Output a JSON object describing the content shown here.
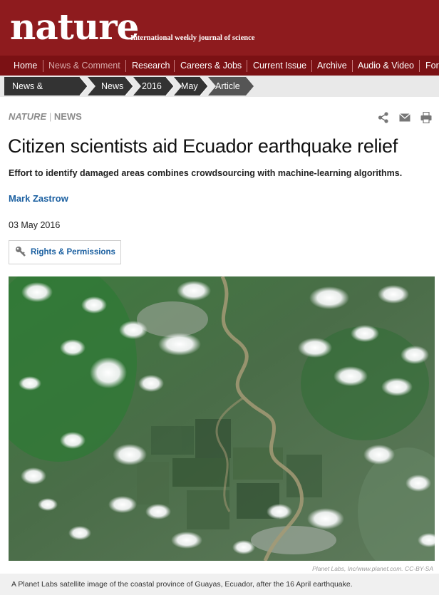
{
  "brand": {
    "logo": "nature",
    "tagline": "International weekly journal of science"
  },
  "nav": {
    "items": [
      {
        "label": "Home"
      },
      {
        "label": "News & Comment",
        "active": true
      },
      {
        "label": "Research"
      },
      {
        "label": "Careers & Jobs"
      },
      {
        "label": "Current Issue"
      },
      {
        "label": "Archive"
      },
      {
        "label": "Audio & Video"
      },
      {
        "label": "For"
      }
    ]
  },
  "breadcrumb": [
    "News & Comment",
    "News",
    "2016",
    "May",
    "Article"
  ],
  "article": {
    "kicker_journal": "NATURE",
    "kicker_sep": "|",
    "kicker_section": "NEWS",
    "title": "Citizen scientists aid Ecuador earthquake relief",
    "standfirst": "Effort to identify damaged areas combines crowdsourcing with machine-learning algorithms.",
    "author": "Mark Zastrow",
    "date": "03 May 2016",
    "rights_label": "Rights & Permissions",
    "tools": [
      "share-icon",
      "email-icon",
      "print-icon"
    ]
  },
  "figure": {
    "credit": "Planet Labs, Inc/www.planet.com. CC-BY-SA",
    "caption": "A Planet Labs satellite image of the coastal province of Guayas, Ecuador, after the 16 April earthquake."
  },
  "colors": {
    "masthead": "#8e1b1e",
    "nav": "#7b1114",
    "link": "#1a5fa0",
    "crumb": "#333333"
  }
}
